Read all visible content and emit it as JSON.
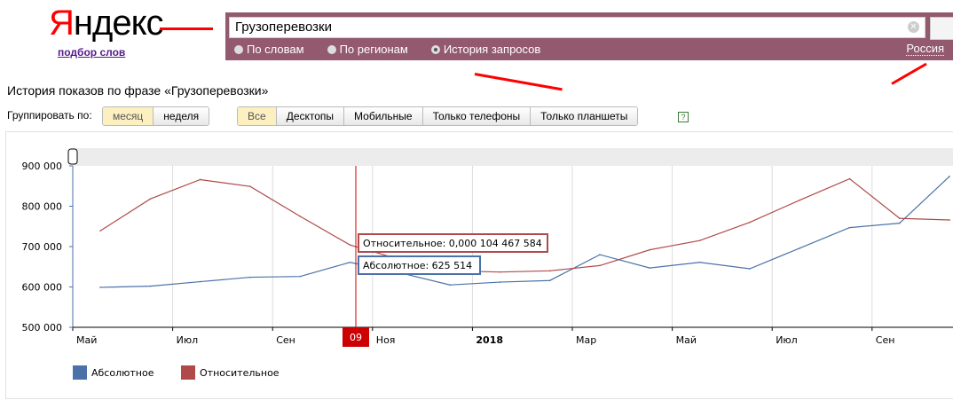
{
  "header": {
    "logo": "Яндекс",
    "logo_first": "Я",
    "logo_rest": "ндекс",
    "subtitle": "подбор слов"
  },
  "search": {
    "value": "Грузоперевозки",
    "modes": [
      {
        "label": "По словам",
        "selected": false
      },
      {
        "label": "По регионам",
        "selected": false
      },
      {
        "label": "История запросов",
        "selected": true
      }
    ],
    "region": "Россия"
  },
  "page_title": "История показов по фразе «Грузоперевозки»",
  "group_by": {
    "label": "Группировать по:",
    "options": [
      {
        "label": "месяц",
        "selected": true
      },
      {
        "label": "неделя",
        "selected": false
      }
    ]
  },
  "devices": [
    {
      "label": "Все",
      "selected": true
    },
    {
      "label": "Десктопы"
    },
    {
      "label": "Мобильные"
    },
    {
      "label": "Только телефоны"
    },
    {
      "label": "Только планшеты"
    }
  ],
  "help": "?",
  "chart_data": {
    "type": "line",
    "x": [
      "2017-05",
      "2017-06",
      "2017-07",
      "2017-08",
      "2017-09",
      "2017-10",
      "2017-11",
      "2017-12",
      "2018-01",
      "2018-02",
      "2018-03",
      "2018-04",
      "2018-05",
      "2018-06",
      "2018-07",
      "2018-08",
      "2018-09",
      "2018-10"
    ],
    "series": [
      {
        "name": "Абсолютное",
        "color": "#4a72a8",
        "values": [
          599000,
          602000,
          613000,
          624000,
          626000,
          661000,
          635000,
          605000,
          612000,
          616000,
          680000,
          647000,
          661000,
          645000,
          696000,
          747000,
          758000,
          874000
        ]
      },
      {
        "name": "Относительное",
        "color": "#b04a4a",
        "values": [
          739000,
          818000,
          866000,
          849000,
          775000,
          704000,
          668000,
          640000,
          637000,
          640000,
          653000,
          692000,
          715000,
          760000,
          815000,
          868000,
          770000,
          766000
        ]
      }
    ],
    "ylim": [
      500000,
      900000
    ],
    "yticks": [
      "900 000",
      "800 000",
      "700 000",
      "600 000",
      "500 000"
    ],
    "xticks": [
      "Май",
      "Июл",
      "Сен",
      "Ноя",
      "2018",
      "Мар",
      "Май",
      "Июл",
      "Сен"
    ],
    "cursor_label": "09",
    "tooltips": {
      "relative": "Относительное: 0,000 104 467 584",
      "absolute": "Абсолютное: 625 514"
    },
    "legend": [
      "Абсолютное",
      "Относительное"
    ]
  }
}
